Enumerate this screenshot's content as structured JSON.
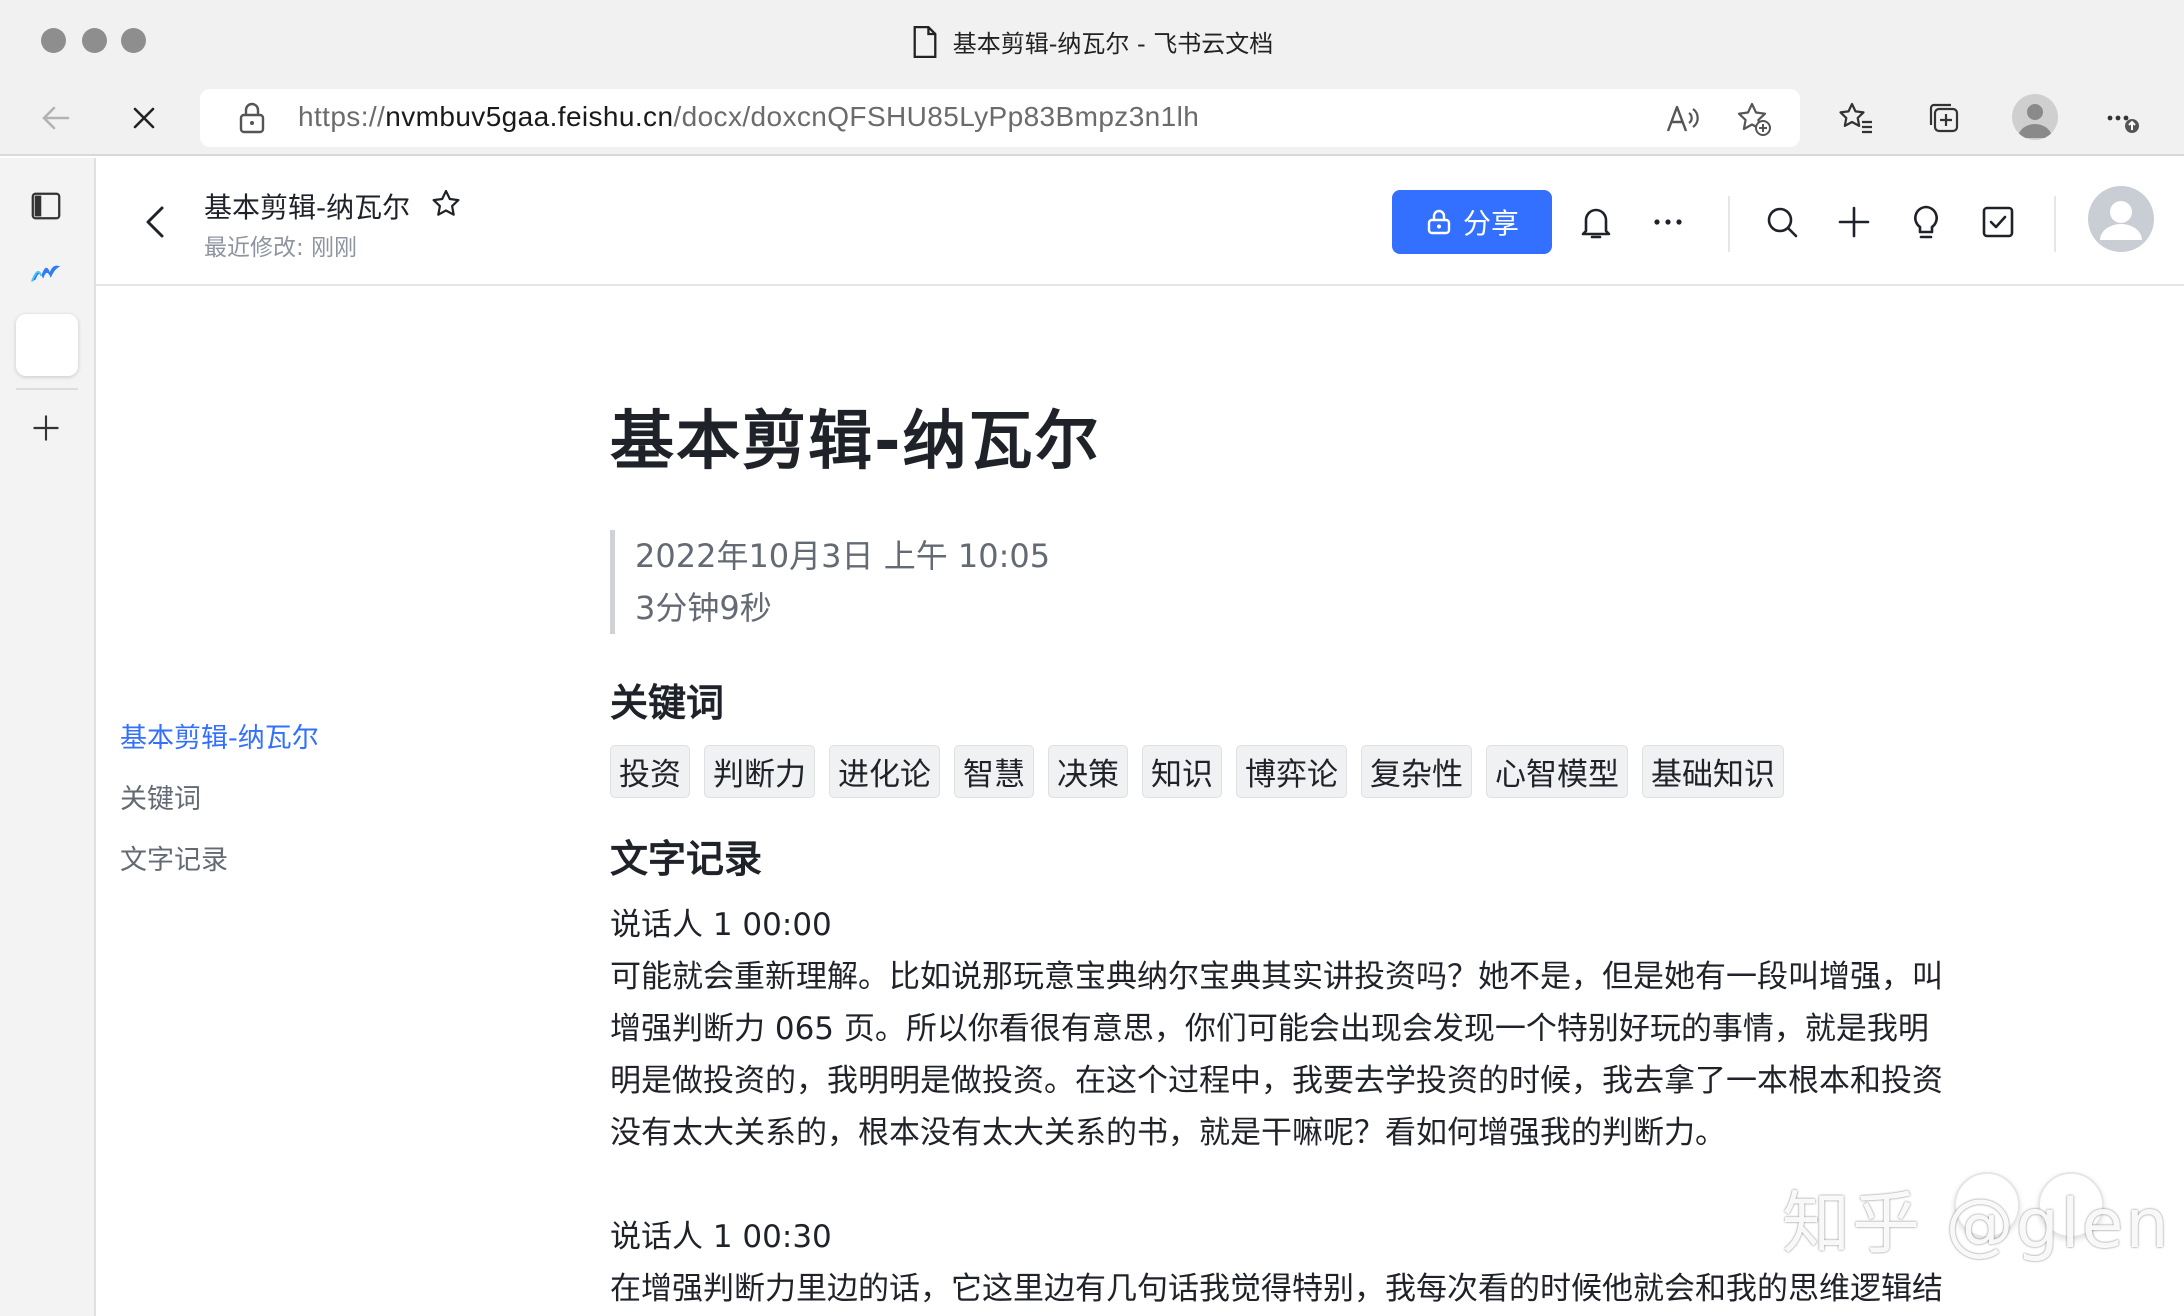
{
  "window": {
    "tab_title": "基本剪辑-纳瓦尔 - 飞书云文档"
  },
  "toolbar": {
    "url_prefix": "https://",
    "url_host": "nvmbuv5gaa.feishu.cn",
    "url_path": "/docx/doxcnQFSHU85LyPp83Bmpz3n1lh"
  },
  "header": {
    "doc_title": "基本剪辑-纳瓦尔",
    "last_modified": "最近修改: 刚刚",
    "share_label": "分享",
    "accent_color": "#3370ff"
  },
  "outline": {
    "items": [
      {
        "label": "基本剪辑-纳瓦尔"
      },
      {
        "label": "关键词"
      },
      {
        "label": "文字记录"
      }
    ]
  },
  "doc": {
    "title": "基本剪辑-纳瓦尔",
    "meta_date": "2022年10月3日 上午 10:05",
    "meta_duration": "3分钟9秒",
    "keywords_heading": "关键词",
    "keywords": [
      "投资",
      "判断力",
      "进化论",
      "智慧",
      "决策",
      "知识",
      "博弈论",
      "复杂性",
      "心智模型",
      "基础知识"
    ],
    "transcript_heading": "文字记录",
    "transcript": [
      {
        "speaker": "说话人 1 00:00",
        "lines": [
          "可能就会重新理解。比如说那玩意宝典纳尔宝典其实讲投资吗？她不是，但是她有一段叫增强，叫",
          "增强判断力 065 页。所以你看很有意思，你们可能会出现会发现一个特别好玩的事情，就是我明",
          "明是做投资的，我明明是做投资。在这个过程中，我要去学投资的时候，我去拿了一本根本和投资",
          "没有太大关系的，根本没有太大关系的书，就是干嘛呢？看如何增强我的判断力。"
        ]
      },
      {
        "speaker": "说话人 1 00:30",
        "lines": [
          "在增强判断力里边的话，它这里边有几句话我觉得特别，我每次看的时候他就会和我的思维逻辑结"
        ]
      }
    ]
  },
  "watermark": {
    "text": "知乎 @glen"
  }
}
